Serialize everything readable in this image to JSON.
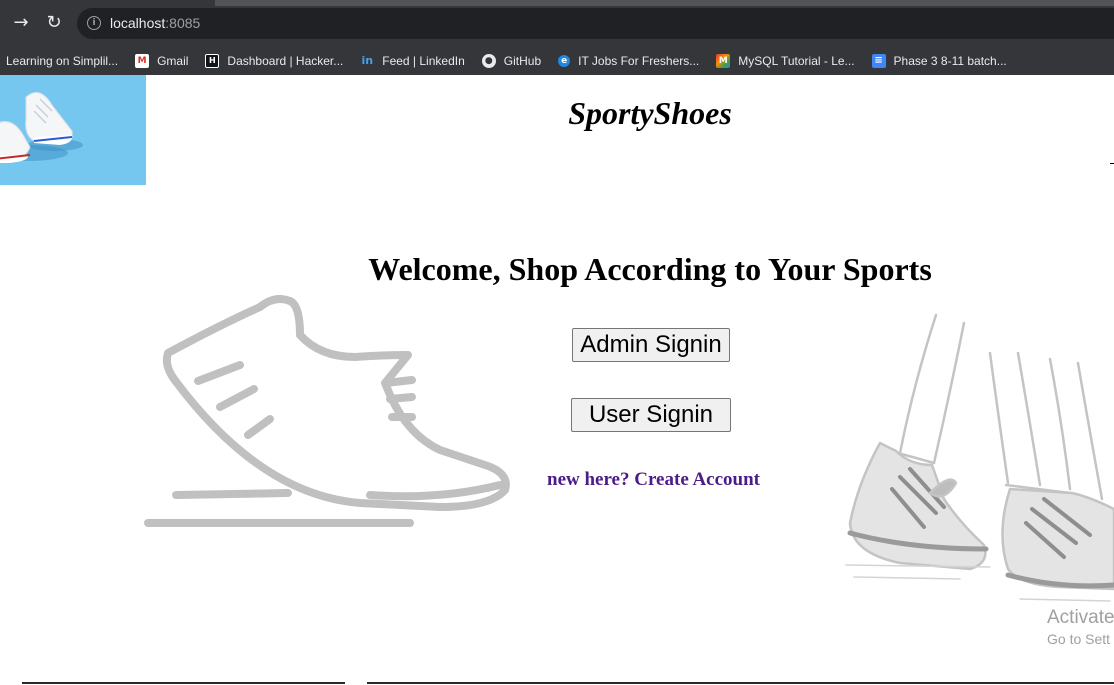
{
  "browser": {
    "url_host": "localhost",
    "url_port": ":8085",
    "bookmarks": [
      {
        "label": "Learning on Simplil...",
        "icon": "none"
      },
      {
        "label": "Gmail",
        "icon": "gmail-icon"
      },
      {
        "label": "Dashboard | Hacker...",
        "icon": "hackerrank-icon"
      },
      {
        "label": "Feed | LinkedIn",
        "icon": "linkedin-icon"
      },
      {
        "label": "GitHub",
        "icon": "github-icon"
      },
      {
        "label": "IT Jobs For Freshers...",
        "icon": "freshers-icon"
      },
      {
        "label": "MySQL Tutorial - Le...",
        "icon": "mysql-icon"
      },
      {
        "label": "Phase 3 8-11 batch...",
        "icon": "docs-icon"
      }
    ]
  },
  "page": {
    "site_title": "SportyShoes",
    "welcome": "Welcome, Shop According to Your Sports",
    "admin_button": "Admin Signin",
    "user_button": "User Signin",
    "create_account_link": "new here? Create Account"
  },
  "watermark": {
    "line1": "Activate",
    "line2": "Go to Sett"
  },
  "colors": {
    "chrome": "#35363a",
    "logo_bg": "#76c7f0",
    "link": "#4b1d88",
    "illustration": "#c0c0c0"
  }
}
